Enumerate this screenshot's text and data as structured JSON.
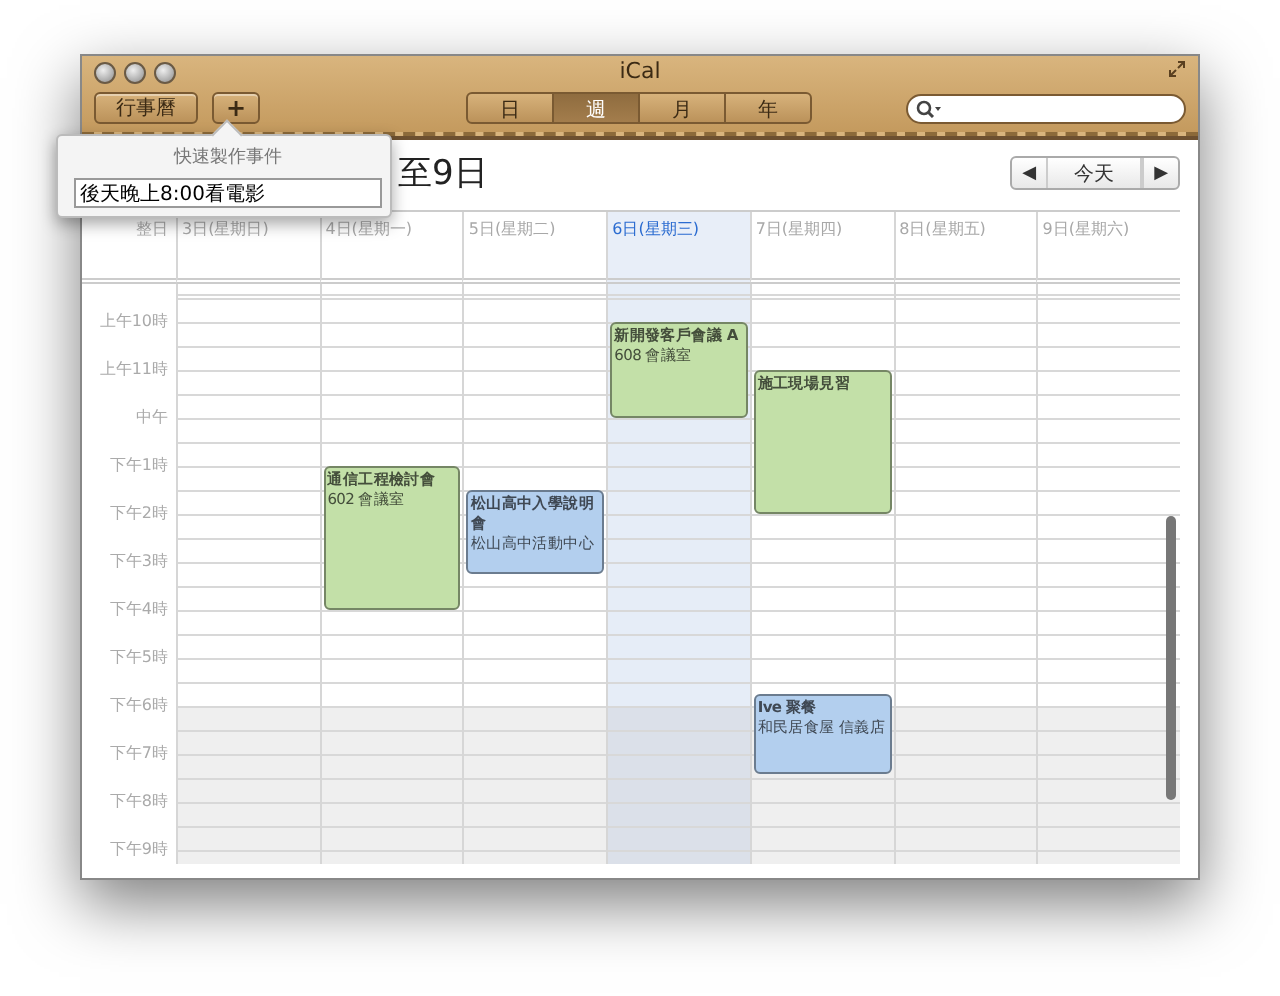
{
  "window": {
    "title": "iCal"
  },
  "toolbar": {
    "calendars_button": "行事曆",
    "add_button": "+",
    "views": [
      {
        "label": "日",
        "selected": false
      },
      {
        "label": "週",
        "selected": true
      },
      {
        "label": "月",
        "selected": false
      },
      {
        "label": "年",
        "selected": false
      }
    ]
  },
  "quick_event": {
    "title": "快速製作事件",
    "value": "後天晚上8:00看電影"
  },
  "header": {
    "title": "至9日",
    "prev": "◀",
    "today": "今天",
    "next": "▶"
  },
  "calendar": {
    "all_day_label": "整日",
    "days": [
      {
        "label": "3日(星期日)",
        "selected": false
      },
      {
        "label": "4日(星期一)",
        "selected": false,
        "events": [
          {
            "title": "通信工程檢討會",
            "location": "602 會議室",
            "color": "#c3e0a8"
          }
        ]
      },
      {
        "label": "5日(星期二)",
        "selected": false,
        "events": [
          {
            "title": "松山高中入學說明會",
            "location": "松山高中活動中心",
            "color": "#b3cfee"
          }
        ]
      },
      {
        "label": "6日(星期三)",
        "selected": true,
        "events": [
          {
            "title": "新開發客戶會議 A",
            "location": "608 會議室",
            "color": "#c3e0a8"
          }
        ]
      },
      {
        "label": "7日(星期四)",
        "selected": false,
        "events": [
          {
            "title": "施工現場見習",
            "color": "#c3e0a8"
          },
          {
            "title": "Ive 聚餐",
            "location": "和民居食屋 信義店",
            "color": "#b3cfee"
          }
        ]
      },
      {
        "label": "8日(星期五)",
        "selected": false
      },
      {
        "label": "9日(星期六)",
        "selected": false
      }
    ],
    "times": [
      "上午10時",
      "上午11時",
      "中午",
      "下午1時",
      "下午2時",
      "下午3時",
      "下午4時",
      "下午5時",
      "下午6時",
      "下午7時",
      "下午8時",
      "下午9時"
    ]
  }
}
